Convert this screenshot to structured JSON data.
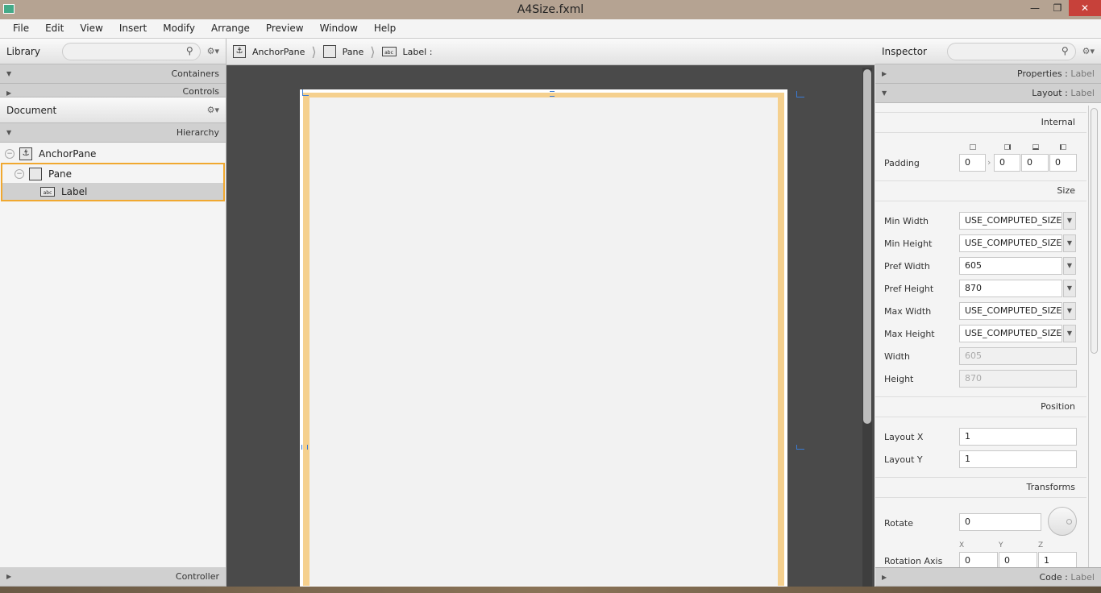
{
  "title": "A4Size.fxml",
  "menu": [
    "File",
    "Edit",
    "View",
    "Insert",
    "Modify",
    "Arrange",
    "Preview",
    "Window",
    "Help"
  ],
  "library": {
    "title": "Library",
    "sections": [
      "Containers",
      "Controls"
    ]
  },
  "document": {
    "title": "Document",
    "section": "Hierarchy",
    "tree": [
      "AnchorPane",
      "Pane",
      "Label"
    ]
  },
  "controller": "Controller",
  "breadcrumb": [
    "AnchorPane",
    "Pane",
    "Label :"
  ],
  "inspector": {
    "title": "Inspector",
    "properties": {
      "name": "Properties",
      "target": "Label"
    },
    "layout": {
      "name": "Layout",
      "target": "Label"
    },
    "code": {
      "name": "Code",
      "target": "Label"
    },
    "internal": "Internal",
    "padding": {
      "label": "Padding",
      "values": [
        "0",
        "0",
        "0",
        "0"
      ]
    },
    "size_header": "Size",
    "size": [
      {
        "label": "Min Width",
        "value": "USE_COMPUTED_SIZE"
      },
      {
        "label": "Min Height",
        "value": "USE_COMPUTED_SIZE"
      },
      {
        "label": "Pref Width",
        "value": "605"
      },
      {
        "label": "Pref Height",
        "value": "870"
      },
      {
        "label": "Max Width",
        "value": "USE_COMPUTED_SIZE"
      },
      {
        "label": "Max Height",
        "value": "USE_COMPUTED_SIZE"
      }
    ],
    "width": {
      "label": "Width",
      "value": "605"
    },
    "height": {
      "label": "Height",
      "value": "870"
    },
    "position_header": "Position",
    "layout_x": {
      "label": "Layout X",
      "value": "1"
    },
    "layout_y": {
      "label": "Layout Y",
      "value": "1"
    },
    "transforms_header": "Transforms",
    "rotate": {
      "label": "Rotate",
      "value": "0"
    },
    "rotation_axis": {
      "label": "Rotation Axis",
      "axes": [
        "X",
        "Y",
        "Z"
      ],
      "values": [
        "0",
        "0",
        "1"
      ]
    }
  },
  "colors": {
    "selection": "#f0a830",
    "page_band": "#f5d08e",
    "canvas": "#4a4a4a",
    "guide": "#3a7bd5"
  }
}
